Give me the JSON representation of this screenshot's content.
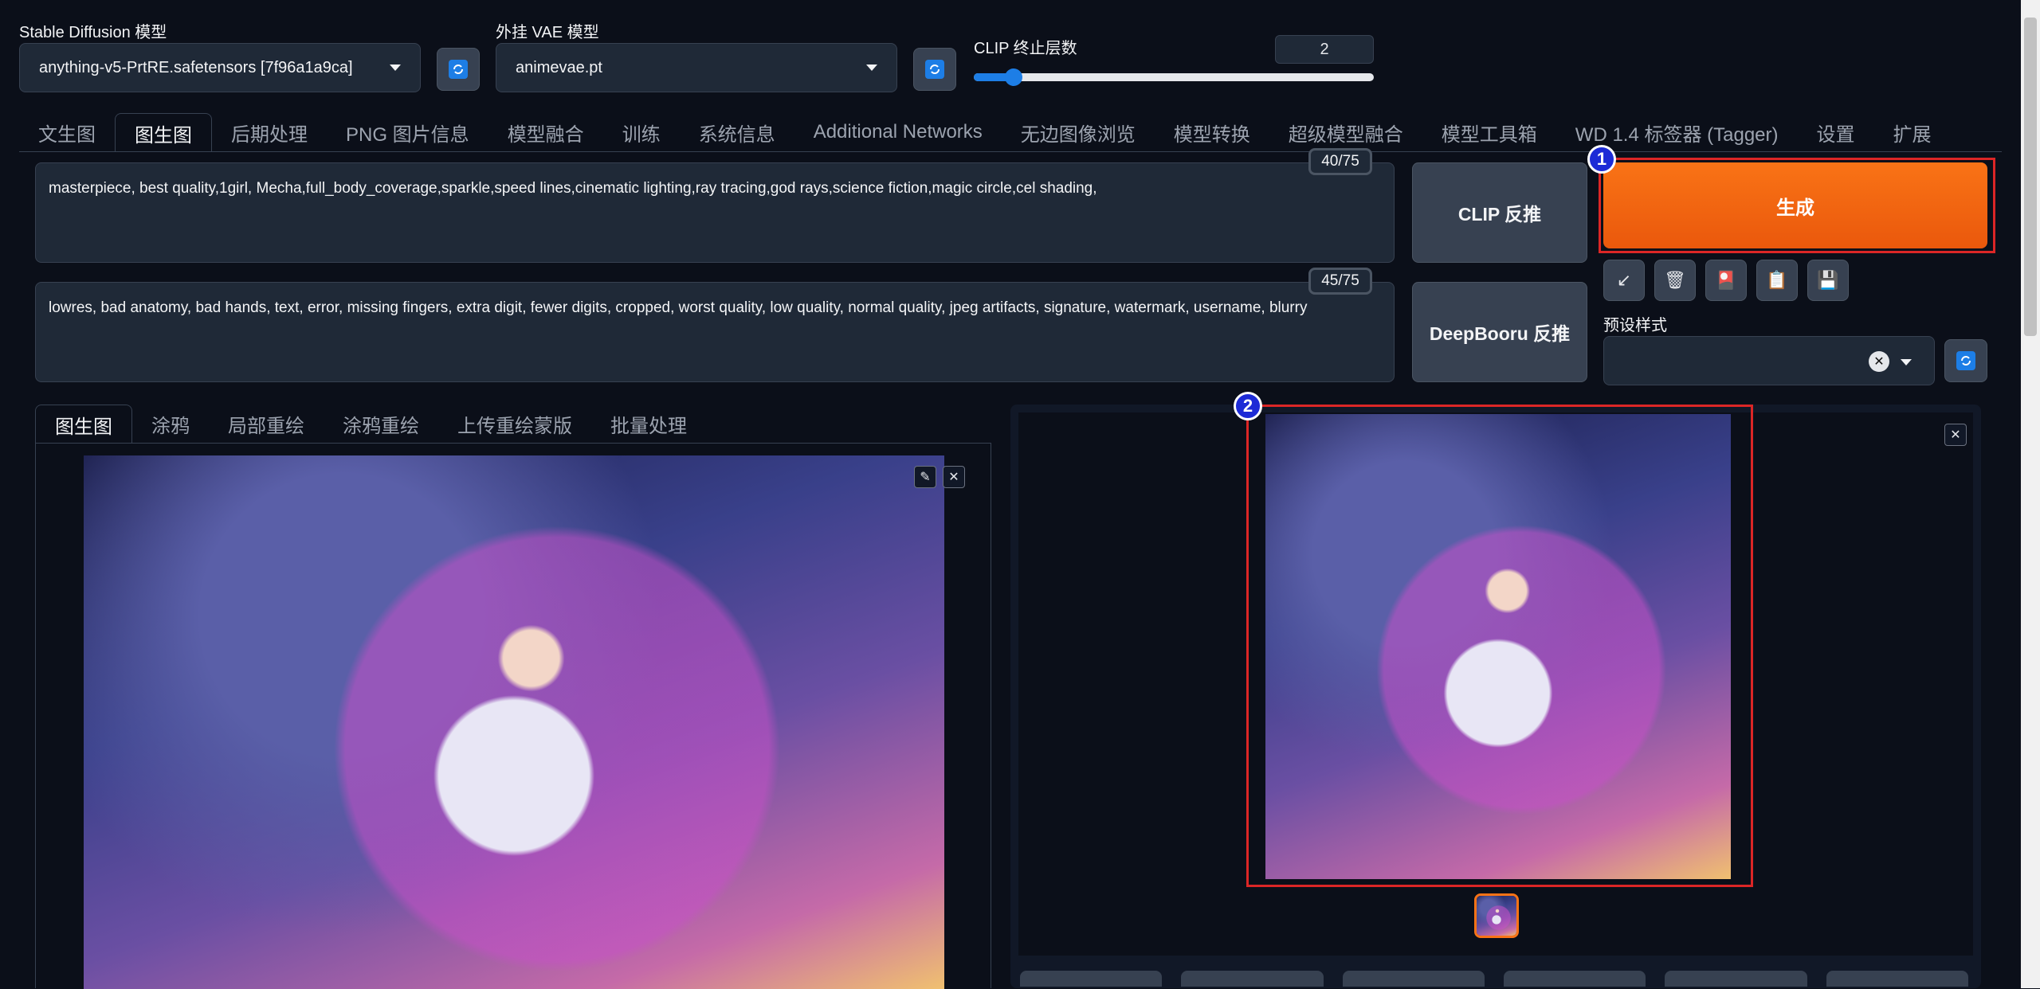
{
  "sd_model": {
    "label": "Stable Diffusion 模型",
    "value": "anything-v5-PrtRE.safetensors [7f96a1a9ca]"
  },
  "vae_model": {
    "label": "外挂 VAE 模型",
    "value": "animevae.pt"
  },
  "clip_skip": {
    "label": "CLIP 终止层数",
    "value": "2",
    "slider_fraction": 0.1
  },
  "main_tabs": [
    "文生图",
    "图生图",
    "后期处理",
    "PNG 图片信息",
    "模型融合",
    "训练",
    "系统信息",
    "Additional Networks",
    "无边图像浏览",
    "模型转换",
    "超级模型融合",
    "模型工具箱",
    "WD 1.4 标签器 (Tagger)",
    "设置",
    "扩展"
  ],
  "prompt": {
    "positive": "masterpiece, best quality,1girl, Mecha,full_body_coverage,sparkle,speed lines,cinematic lighting,ray tracing,god rays,science fiction,magic circle,cel shading,",
    "positive_tokens": "40/75",
    "negative": "lowres, bad anatomy, bad hands, text, error, missing fingers, extra digit, fewer digits, cropped, worst quality, low quality, normal quality, jpeg artifacts, signature, watermark, username, blurry",
    "negative_tokens": "45/75"
  },
  "interrogate": {
    "clip": "CLIP 反推",
    "deepbooru": "DeepBooru 反推"
  },
  "generate_label": "生成",
  "styles_label": "预设样式",
  "sub_tabs": [
    "图生图",
    "涂鸦",
    "局部重绘",
    "涂鸦重绘",
    "上传重绘蒙版",
    "批量处理"
  ],
  "annotations": {
    "one": "1",
    "two": "2"
  },
  "icons": {
    "tool_buttons": [
      "arrow-down-left-icon",
      "trash-icon",
      "style-card-icon",
      "clipboard-icon",
      "save-icon"
    ],
    "tool_glyphs": [
      "↙",
      "🗑",
      "🎴",
      "📋",
      "💾"
    ]
  },
  "colors": {
    "generate": "#f97316",
    "accent": "#1d7ee6",
    "annotation_border": "#dc2626"
  }
}
